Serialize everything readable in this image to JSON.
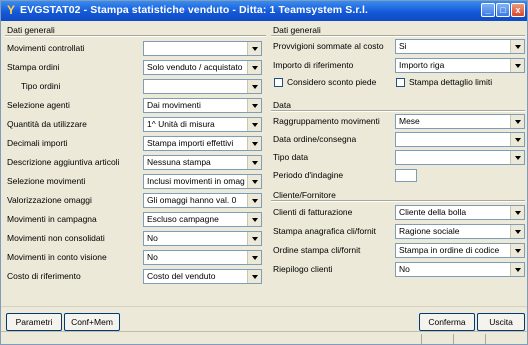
{
  "window": {
    "title": "EVGSTAT02 - Stampa statistiche venduto - Ditta: 1 Teamsystem S.r.l.",
    "app_icon": "Y"
  },
  "left": {
    "section": "Dati generali",
    "rows": [
      {
        "label": "Movimenti controllati",
        "value": ""
      },
      {
        "label": "Stampa ordini",
        "value": "Solo venduto / acquistato"
      },
      {
        "label": "Tipo ordini",
        "value": ""
      },
      {
        "label": "Selezione agenti",
        "value": "Dai movimenti"
      },
      {
        "label": "Quantità da utilizzare",
        "value": "1^ Unità di misura"
      },
      {
        "label": "Decimali importi",
        "value": "Stampa importi effettivi"
      },
      {
        "label": "Descrizione aggiuntiva articoli",
        "value": "Nessuna stampa"
      },
      {
        "label": "Selezione movimenti",
        "value": "Inclusi movimenti in omag."
      },
      {
        "label": "Valorizzazione omaggi",
        "value": "Gli omaggi hanno val. 0"
      },
      {
        "label": "Movimenti in campagna",
        "value": "Escluso campagne"
      },
      {
        "label": "Movimenti non consolidati",
        "value": "No"
      },
      {
        "label": "Movimenti in conto visione",
        "value": "No"
      },
      {
        "label": "Costo di riferimento",
        "value": "Costo del venduto"
      }
    ]
  },
  "right": {
    "section_general": "Dati generali",
    "provvigioni_label": "Provvigioni sommate al costo",
    "provvigioni_value": "Si",
    "importo_label": "Importo di riferimento",
    "importo_value": "Importo riga",
    "check_sconto": "Considero sconto piede",
    "check_limiti": "Stampa dettaglio limiti",
    "section_data": "Data",
    "raggruppamento_label": "Raggruppamento movimenti",
    "raggruppamento_value": "Mese",
    "data_ordine_label": "Data ordine/consegna",
    "data_ordine_value": "",
    "tipo_data_label": "Tipo data",
    "tipo_data_value": "",
    "periodo_label": "Periodo d'indagine",
    "section_cliente": "Cliente/Fornitore",
    "clienti_fatt_label": "Clienti di fatturazione",
    "clienti_fatt_value": "Cliente della bolla",
    "anagrafica_label": "Stampa anagrafica cli/fornit",
    "anagrafica_value": "Ragione sociale",
    "ordine_label": "Ordine stampa cli/fornit",
    "ordine_value": "Stampa in ordine di codice",
    "riepilogo_label": "Riepilogo clienti",
    "riepilogo_value": "No"
  },
  "footer": {
    "parametri": "Parametri",
    "confmem": "Conf+Mem",
    "conferma": "Conferma",
    "uscita": "Uscita"
  }
}
